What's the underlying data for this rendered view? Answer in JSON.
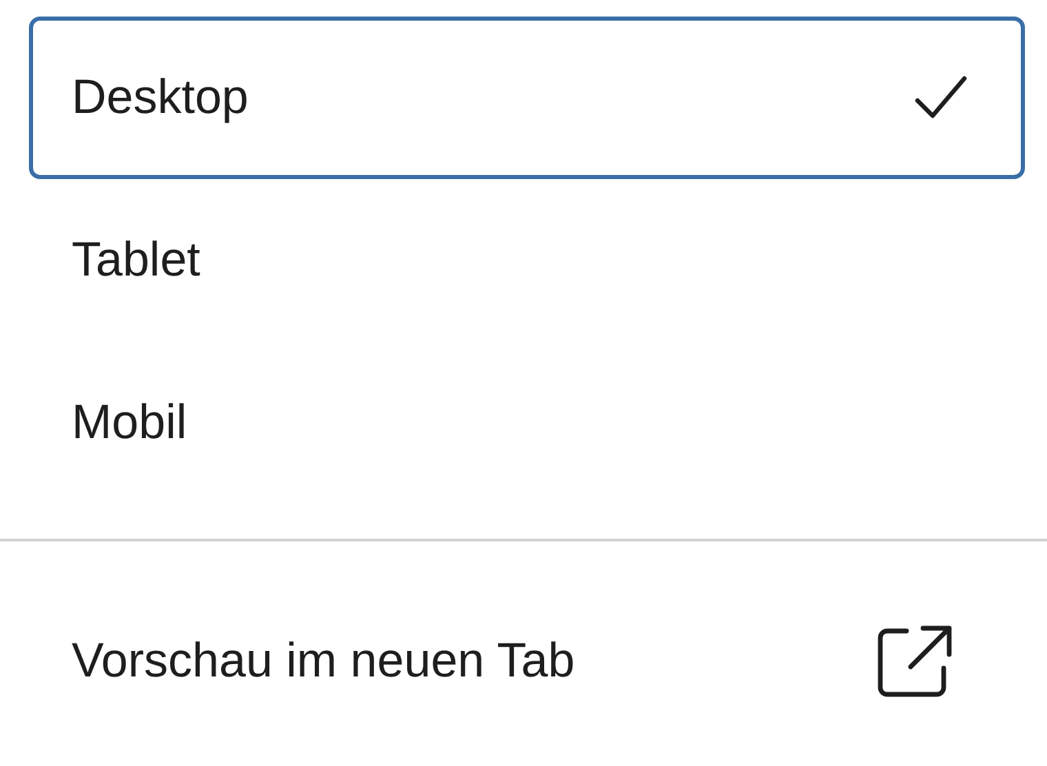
{
  "view_options": [
    {
      "label": "Desktop",
      "selected": true
    },
    {
      "label": "Tablet",
      "selected": false
    },
    {
      "label": "Mobil",
      "selected": false
    }
  ],
  "action": {
    "label": "Vorschau im neuen Tab"
  }
}
